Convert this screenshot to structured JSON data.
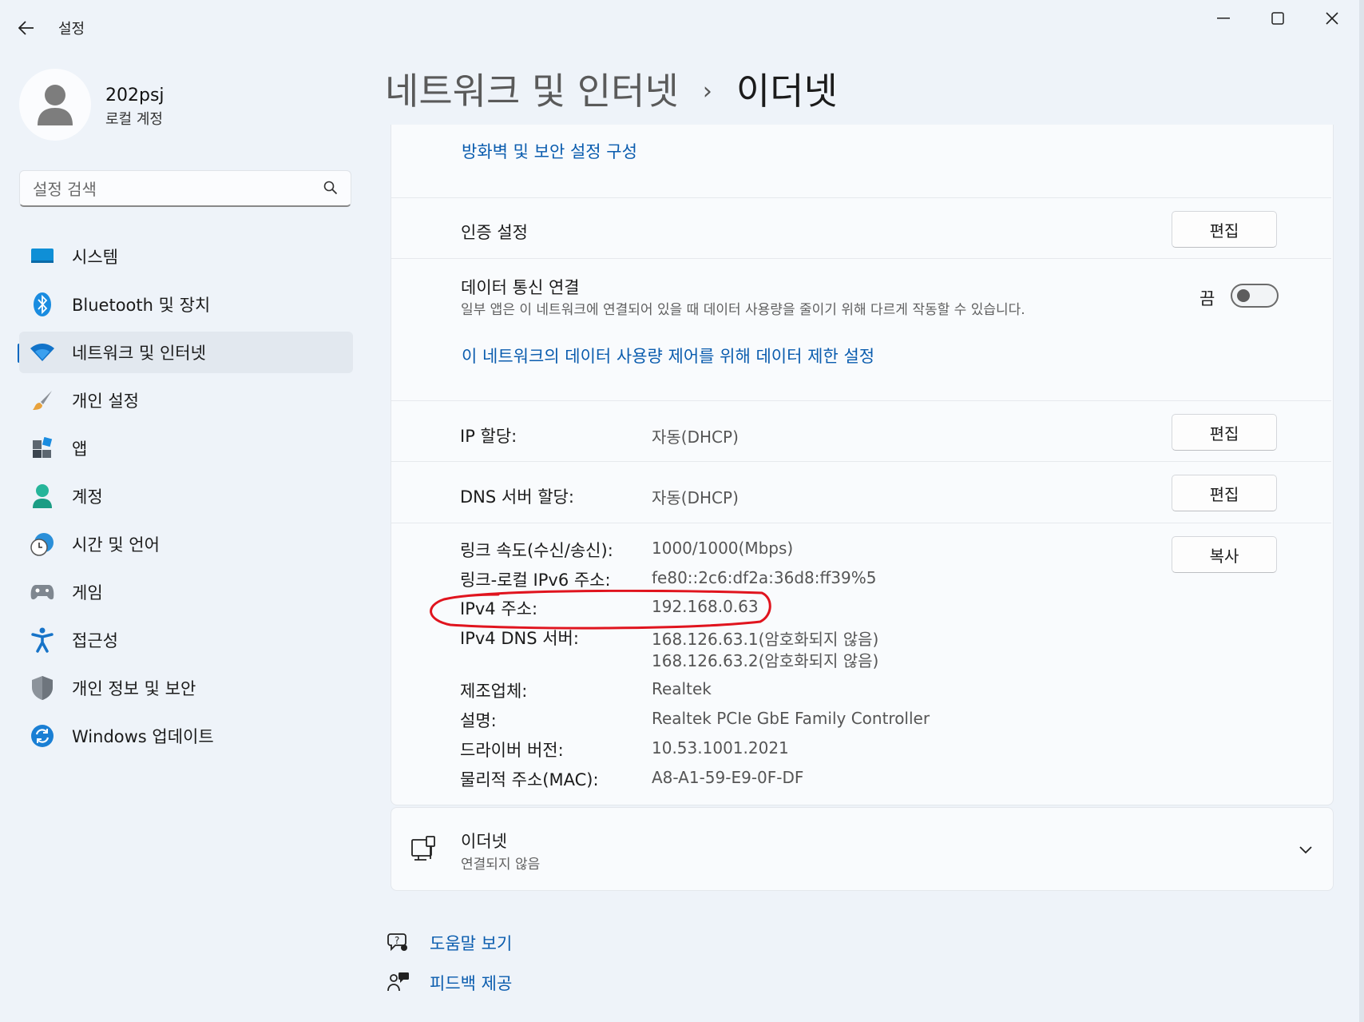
{
  "window": {
    "title": "설정",
    "controls": {
      "minimize": "—",
      "maximize": "☐",
      "close": "✕"
    }
  },
  "profile": {
    "username": "202psj",
    "account_type": "로컬 계정"
  },
  "search": {
    "placeholder": "설정 검색"
  },
  "nav": {
    "items": [
      {
        "label": "시스템",
        "icon": "system-icon"
      },
      {
        "label": "Bluetooth 및 장치",
        "icon": "bluetooth-icon"
      },
      {
        "label": "네트워크 및 인터넷",
        "icon": "network-wifi-icon",
        "active": true
      },
      {
        "label": "개인 설정",
        "icon": "brush-icon"
      },
      {
        "label": "앱",
        "icon": "apps-icon"
      },
      {
        "label": "계정",
        "icon": "account-icon"
      },
      {
        "label": "시간 및 언어",
        "icon": "time-language-icon"
      },
      {
        "label": "게임",
        "icon": "gamepad-icon"
      },
      {
        "label": "접근성",
        "icon": "accessibility-icon"
      },
      {
        "label": "개인 정보 및 보안",
        "icon": "shield-icon"
      },
      {
        "label": "Windows 업데이트",
        "icon": "update-icon"
      }
    ]
  },
  "header": {
    "parent": "네트워크 및 인터넷",
    "separator": "›",
    "current": "이더넷"
  },
  "main": {
    "firewall_link": "방화벽 및 보안 설정 구성",
    "auth": {
      "label": "인증 설정",
      "button": "편집"
    },
    "metered": {
      "title": "데이터 통신 연결",
      "description": "일부 앱은 이 네트워크에 연결되어 있을 때 데이터 사용량을 줄이기 위해 다르게 작동할 수 있습니다.",
      "state_label": "끔",
      "on": false,
      "limit_link": "이 네트워크의 데이터 사용량 제어를 위해 데이터 제한 설정"
    },
    "ip_assignment": {
      "label": "IP 할당:",
      "value": "자동(DHCP)",
      "button": "편집"
    },
    "dns_assignment": {
      "label": "DNS 서버 할당:",
      "value": "자동(DHCP)",
      "button": "편집"
    },
    "copy_button": "복사",
    "properties": [
      {
        "label": "링크 속도(수신/송신):",
        "value": "1000/1000(Mbps)"
      },
      {
        "label": "링크-로컬 IPv6 주소:",
        "value": "fe80::2c6:df2a:36d8:ff39%5"
      },
      {
        "label": "IPv4 주소:",
        "value": "192.168.0.63"
      },
      {
        "label": "IPv4 DNS 서버:",
        "value": "168.126.63.1(암호화되지 않음)",
        "value2": "168.126.63.2(암호화되지 않음)"
      },
      {
        "label": "제조업체:",
        "value": "Realtek"
      },
      {
        "label": "설명:",
        "value": "Realtek PCIe GbE Family Controller"
      },
      {
        "label": "드라이버 버전:",
        "value": "10.53.1001.2021"
      },
      {
        "label": "물리적 주소(MAC):",
        "value": "A8-A1-59-E9-0F-DF"
      }
    ]
  },
  "ethernet_card": {
    "title": "이더넷",
    "status": "연결되지 않음"
  },
  "footer": {
    "help": "도움말 보기",
    "feedback": "피드백 제공"
  },
  "colors": {
    "accent": "#0067c0",
    "link": "#0a5cae",
    "annotation": "#e0141e"
  }
}
